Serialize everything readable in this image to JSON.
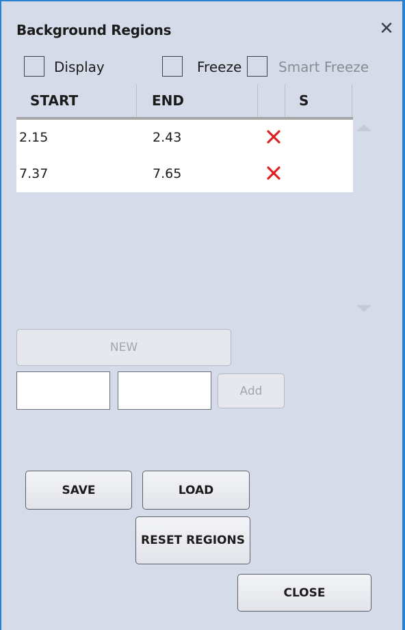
{
  "panel": {
    "title": "Background Regions",
    "close_glyph": "✕"
  },
  "options": {
    "display": {
      "label": "Display",
      "checked": false
    },
    "freeze": {
      "label": "Freeze",
      "checked": false
    },
    "smart_freeze": {
      "label": "Smart Freeze",
      "checked": false,
      "enabled": false
    }
  },
  "table": {
    "columns": [
      "START",
      "END",
      "",
      "S"
    ],
    "rows": [
      {
        "start": "2.15",
        "end": "2.43",
        "delete_icon": "delete-x-icon"
      },
      {
        "start": "7.37",
        "end": "7.65",
        "delete_icon": "delete-x-icon"
      }
    ]
  },
  "controls": {
    "new_label": "NEW",
    "start_input_value": "",
    "end_input_value": "",
    "add_label": "Add"
  },
  "actions": {
    "save_label": "SAVE",
    "load_label": "LOAD",
    "reset_label": "RESET REGIONS",
    "close_label": "CLOSE"
  },
  "colors": {
    "accent_border": "#2b80d0",
    "panel_bg": "#d6dbe9",
    "delete_red": "#e02020"
  }
}
